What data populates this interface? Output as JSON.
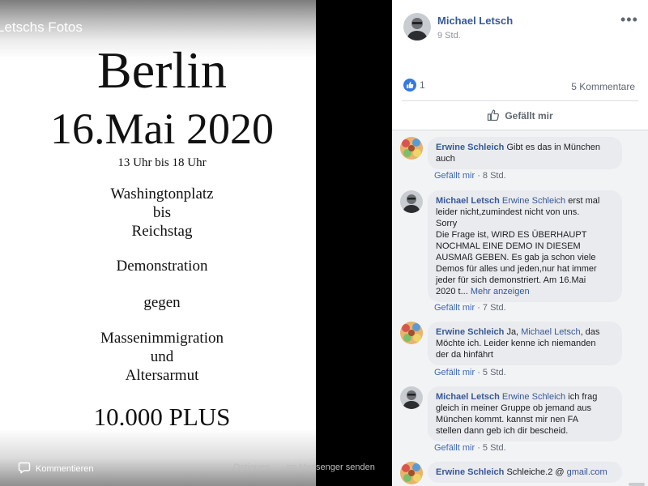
{
  "album": {
    "title": "Letschs Fotos"
  },
  "poster": {
    "city": "Berlin",
    "date": "16.Mai 2020",
    "time": "13 Uhr bis 18 Uhr",
    "route_1": "Washingtonplatz",
    "route_2": "bis",
    "route_3": "Reichstag",
    "type": "Demonstration",
    "against": "gegen",
    "topic_1": "Massenimmigration",
    "topic_2": "und",
    "topic_3": "Altersarmut",
    "tagline": "10.000 PLUS"
  },
  "viewer_bar": {
    "comment_label": "Kommentieren",
    "options_label": "Optionen",
    "messenger_label": "Im Messenger senden"
  },
  "post": {
    "author": "Michael Letsch",
    "time": "9 Std.",
    "more": "•••",
    "like_count": "1",
    "comment_count": "5 Kommentare",
    "like_action": "Gefällt mir"
  },
  "comments": [
    {
      "author": "Erwine Schleich",
      "text_1": "Gibt es das in München",
      "text_2": "auch",
      "like": "Gefällt mir",
      "time": "8 Std."
    },
    {
      "author": "Michael Letsch",
      "mention": "Erwine Schleich",
      "text_1": "erst mal",
      "text_2": "leider nicht,zumindest nicht von uns.",
      "text_3": "Sorry",
      "text_4": "Die Frage ist, WIRD ES ÜBERHAUPT",
      "text_5": "NOCHMAL EINE DEMO IN DIESEM",
      "text_6": "AUSMAß GEBEN. Es gab ja schon viele",
      "text_7": "Demos für alles und jeden,nur hat immer",
      "text_8": "jeder für sich demonstriert. Am 16.Mai",
      "text_9": "2020 t...",
      "more": "Mehr anzeigen",
      "like": "Gefällt mir",
      "time": "7 Std."
    },
    {
      "author": "Erwine Schleich",
      "pre": "Ja,",
      "mention": "Michael Letsch",
      "text_1": ", das",
      "text_2": "Möchte ich. Leider kenne ich niemanden",
      "text_3": "der da hinfährt",
      "like": "Gefällt mir",
      "time": "5 Std."
    },
    {
      "author": "Michael Letsch",
      "mention": "Erwine Schleich",
      "text_1": "ich frag",
      "text_2": "gleich in meiner Gruppe ob jemand aus",
      "text_3": "München kommt. kannst mir nen FA",
      "text_4": "stellen dann geb ich dir bescheid.",
      "like": "Gefällt mir",
      "time": "5 Std."
    },
    {
      "author": "Erwine Schleich",
      "text_1": "Schleiche.2 @",
      "link": "gmail.com"
    }
  ],
  "meta_separator": "·",
  "colors": {
    "link": "#385898",
    "like_blue": "#3578e5",
    "bubble": "#e9ebee",
    "panel_bg": "#f2f3f5"
  },
  "icons": [
    "comment-icon",
    "thumbs-up-icon",
    "like-badge-icon",
    "more-icon"
  ]
}
